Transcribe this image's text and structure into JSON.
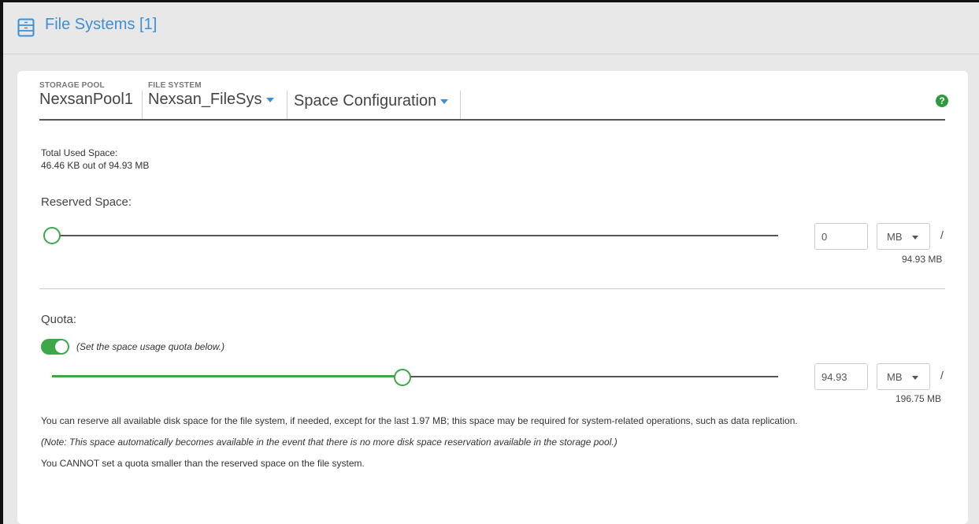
{
  "header": {
    "title": "File Systems [1]"
  },
  "breadcrumb": {
    "pool": {
      "label": "STORAGE POOL",
      "value": "NexsanPool1"
    },
    "fs": {
      "label": "FILE SYSTEM",
      "value": "Nexsan_FileSys"
    },
    "section": {
      "value": "Space Configuration"
    }
  },
  "help": {
    "glyph": "?"
  },
  "usage": {
    "label": "Total Used Space:",
    "value": "46.46 KB out of 94.93 MB"
  },
  "reserved": {
    "label": "Reserved Space:",
    "input_value": "0",
    "unit": "MB",
    "slash": "/",
    "max": "94.93 MB",
    "level_fraction": 0
  },
  "quota": {
    "label": "Quota:",
    "toggle_on": true,
    "toggle_text": "(Set the space usage quota below.)",
    "input_value": "94.93",
    "unit": "MB",
    "slash": "/",
    "max": "196.75 MB",
    "level_fraction": 0.4825
  },
  "notes": {
    "line1": "You can reserve all available disk space for the file system, if needed, except for the last 1.97 MB; this space may be required for system-related operations, such as data replication.",
    "line2": "(Note: This space automatically becomes available in the event that there is no more disk space reservation available in the storage pool.)",
    "line3": "You CANNOT set a quota smaller than the reserved space on the file system."
  },
  "colors": {
    "accent": "#3d8fd6",
    "success": "#3ca84a",
    "help": "#2e9a40"
  }
}
